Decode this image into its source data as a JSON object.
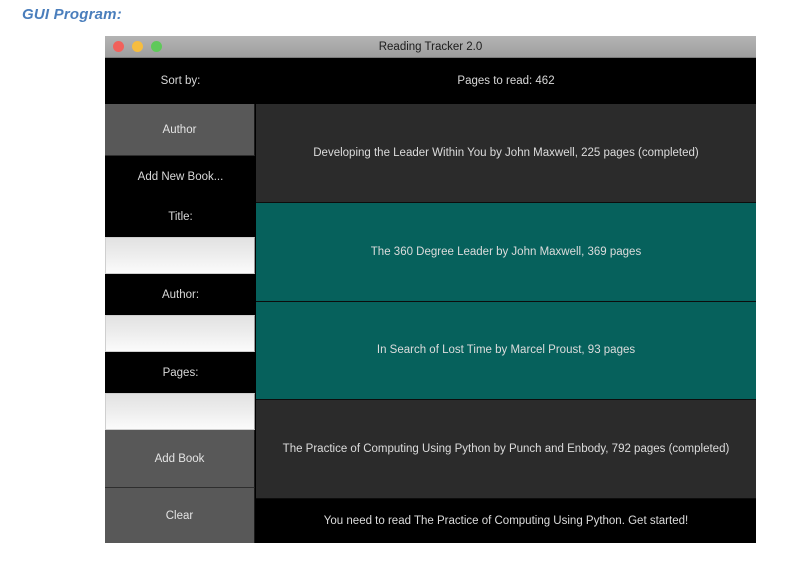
{
  "page": {
    "heading": "GUI Program:"
  },
  "window": {
    "title": "Reading Tracker 2.0",
    "traffic_lights": {
      "close_color": "#f2615b",
      "minimize_color": "#f6bd3f",
      "maximize_color": "#5fc95a"
    }
  },
  "sidebar": {
    "sort_by_label": "Sort by:",
    "sort_by_value": "Author",
    "add_new_book_label": "Add New Book...",
    "fields": [
      {
        "label": "Title:",
        "value": "",
        "placeholder": ""
      },
      {
        "label": "Author:",
        "value": "",
        "placeholder": ""
      },
      {
        "label": "Pages:",
        "value": "",
        "placeholder": ""
      }
    ],
    "add_book_label": "Add Book",
    "clear_label": "Clear"
  },
  "main": {
    "pages_to_read": "Pages to read: 462",
    "books": [
      {
        "text": "Developing the Leader Within You by John Maxwell, 225 pages (completed)",
        "state": "dark"
      },
      {
        "text": "The 360 Degree Leader by John Maxwell, 369 pages",
        "state": "teal"
      },
      {
        "text": "In Search of Lost Time by Marcel Proust, 93 pages",
        "state": "teal"
      },
      {
        "text": "The Practice of Computing Using Python by Punch and Enbody, 792 pages (completed)",
        "state": "dark"
      }
    ],
    "status_message": "You need to read The Practice of Computing Using Python. Get started!"
  },
  "colors": {
    "heading": "#4a7ebc",
    "completed_row": "#2b2b2b",
    "unread_row": "#06615c",
    "button": "#585858",
    "panel_background": "#000000"
  }
}
